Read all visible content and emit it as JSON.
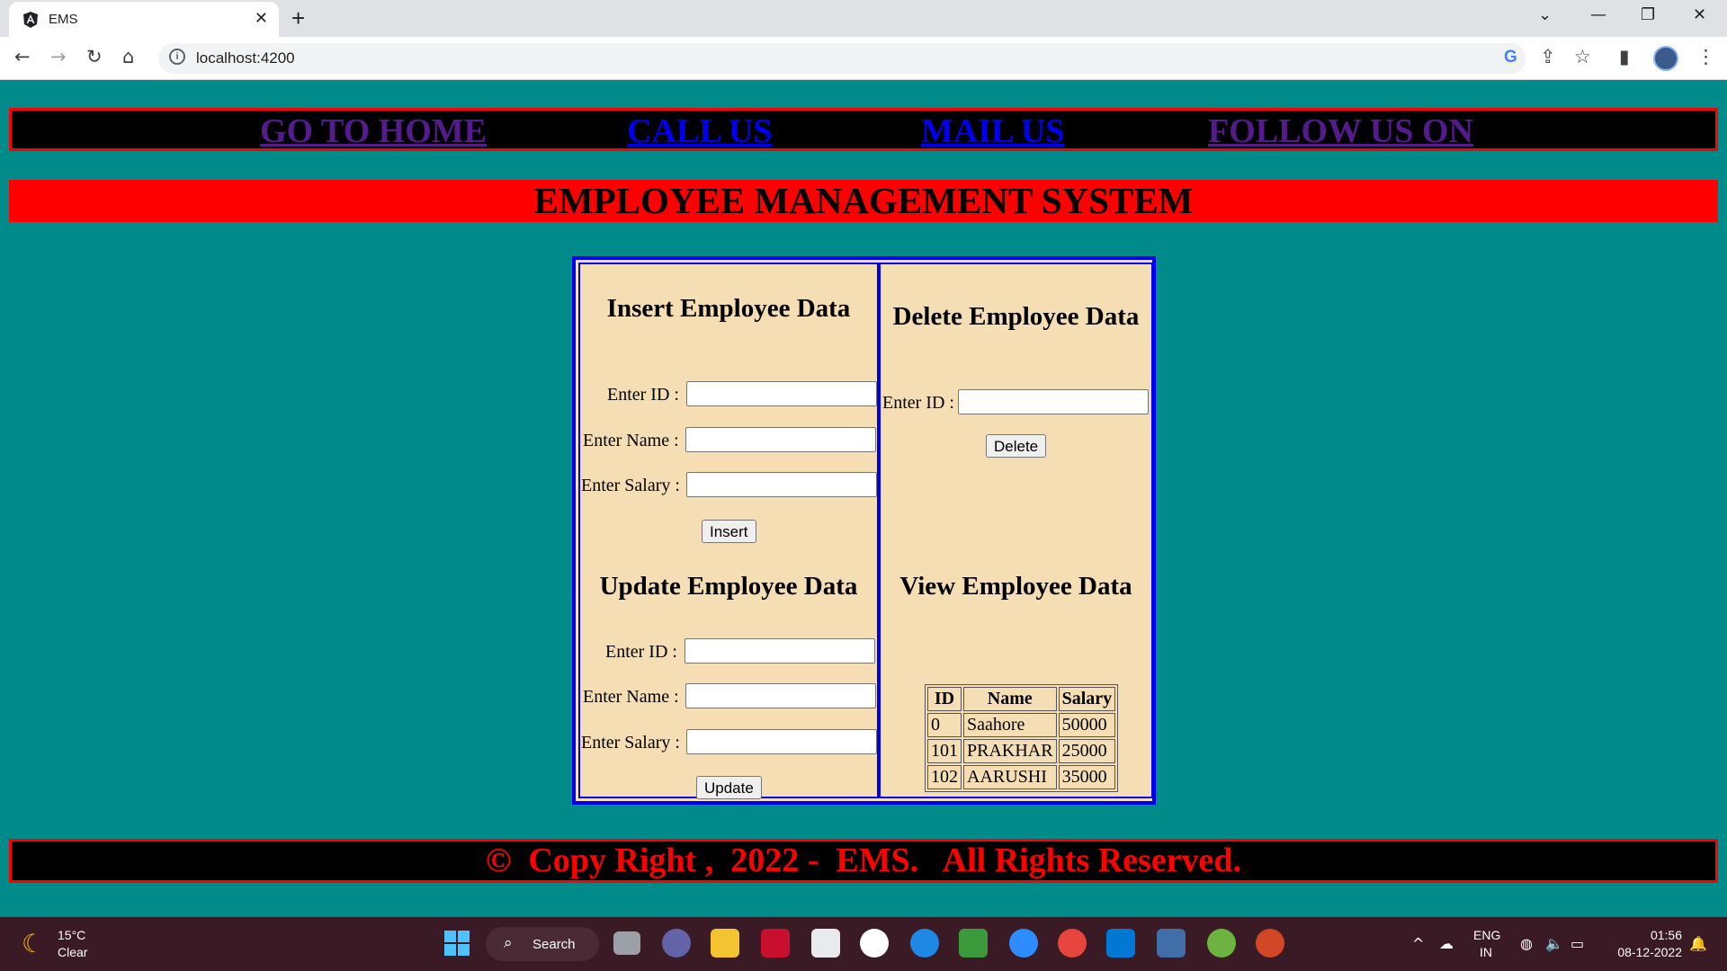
{
  "browser": {
    "tab_title": "EMS",
    "url": "localhost:4200"
  },
  "nav": {
    "links": [
      "GO TO HOME",
      "CALL US",
      "MAIL US",
      "FOLLOW US ON"
    ]
  },
  "banner": "EMPLOYEE MANAGEMENT SYSTEM",
  "insert": {
    "heading": "Insert Employee Data",
    "id_label": "Enter ID :",
    "name_label": "Enter Name :",
    "salary_label": "Enter Salary :",
    "id_value": "",
    "name_value": "",
    "salary_value": "",
    "button": "Insert"
  },
  "delete": {
    "heading": "Delete Employee Data",
    "id_label": "Enter ID :",
    "id_value": "",
    "button": "Delete"
  },
  "update": {
    "heading": "Update Employee Data",
    "id_label": "Enter ID :",
    "name_label": "Enter Name :",
    "salary_label": "Enter Salary :",
    "id_value": "",
    "name_value": "",
    "salary_value": "",
    "button": "Update"
  },
  "view": {
    "heading": "View Employee Data",
    "columns": [
      "ID",
      "Name",
      "Salary"
    ],
    "rows": [
      [
        "0",
        "Saahore",
        "50000"
      ],
      [
        "101",
        "PRAKHAR",
        "25000"
      ],
      [
        "102",
        "AARUSHI",
        "35000"
      ]
    ]
  },
  "footer": "©  Copy Right ,  2022 -  EMS.   All Rights Reserved.",
  "taskbar": {
    "temperature": "15°C",
    "condition": "Clear",
    "search_label": "Search",
    "lang_line1": "ENG",
    "lang_line2": "IN",
    "time": "01:56",
    "date": "08-12-2022"
  },
  "colors": {
    "page_bg": "#008b8b",
    "nav_bg": "#000000",
    "nav_border": "#ff0000",
    "visited_link": "#551a8b",
    "link": "#0000ee",
    "banner_bg": "#ff0000",
    "panel_bg": "#f5deb3",
    "panel_border": "#0000ee",
    "footer_text": "#ff0000"
  }
}
